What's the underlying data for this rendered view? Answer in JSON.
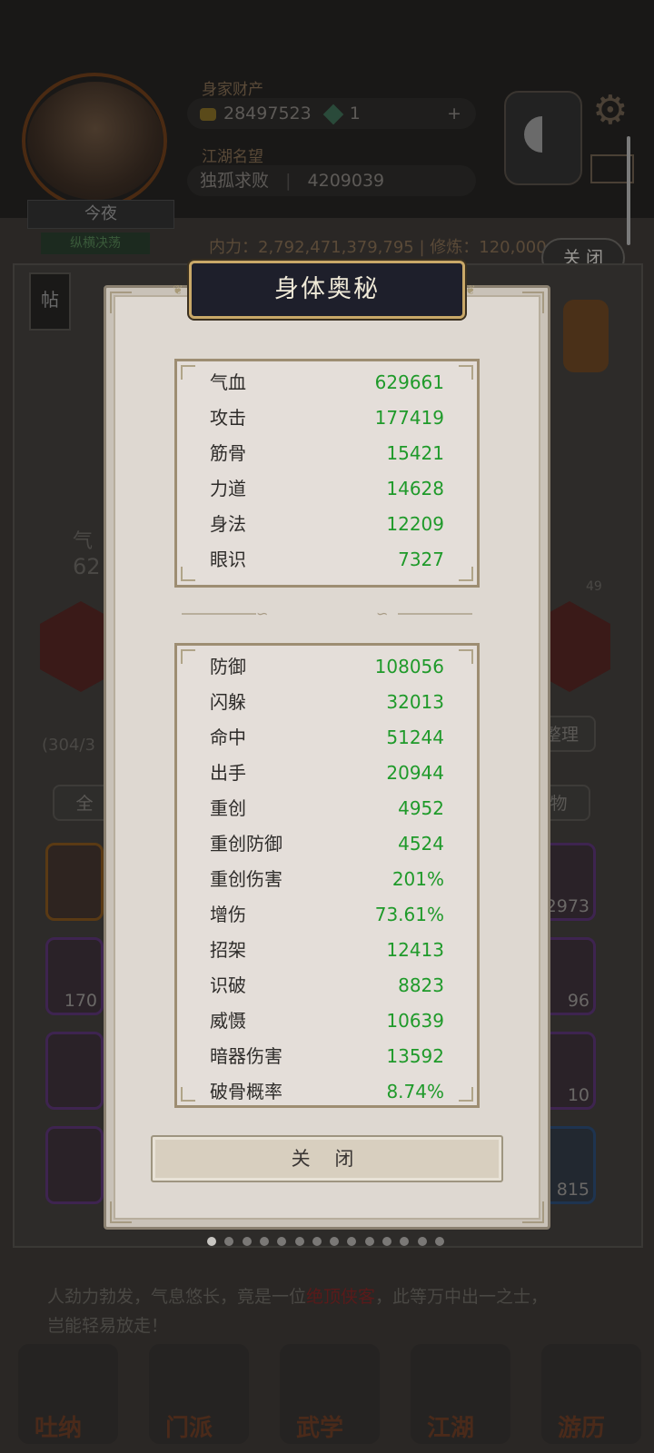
{
  "background": {
    "player_name": "今夜",
    "player_title": "纵横决荡",
    "wealth_label": "身家财产",
    "coins": "28497523",
    "gems": "1",
    "plus": "+",
    "reputation_label": "江湖名望",
    "reputation_title": "独孤求败",
    "reputation_value": "4209039",
    "info_line": "内力：2,792,471,379,795 | 修炼：120,000",
    "close_label": "关 闭",
    "tie_label": "帖",
    "left_value": "62",
    "left_label": "气",
    "progress_text": "(304/3",
    "sort_label": "整理",
    "tab_all": "全",
    "tab_item": "物",
    "item_counts": [
      "170",
      "2973",
      "96",
      "10",
      "815"
    ],
    "side_num": "49",
    "description_pre": "人劲力勃发，气息悠长，竟是一位",
    "description_hl": "绝顶侠客",
    "description_post": "，此等万中出一之士，",
    "description_line2": "岂能轻易放走！",
    "nav": [
      "吐纳",
      "门派",
      "武学",
      "江湖",
      "游历"
    ]
  },
  "modal": {
    "title": "身体奥秘",
    "primary_stats": [
      {
        "label": "气血",
        "value": "629661"
      },
      {
        "label": "攻击",
        "value": "177419"
      },
      {
        "label": "筋骨",
        "value": "15421"
      },
      {
        "label": "力道",
        "value": "14628"
      },
      {
        "label": "身法",
        "value": "12209"
      },
      {
        "label": "眼识",
        "value": "7327"
      }
    ],
    "secondary_stats": [
      {
        "label": "防御",
        "value": "108056"
      },
      {
        "label": "闪躲",
        "value": "32013"
      },
      {
        "label": "命中",
        "value": "51244"
      },
      {
        "label": "出手",
        "value": "20944"
      },
      {
        "label": "重创",
        "value": "4952"
      },
      {
        "label": "重创防御",
        "value": "4524"
      },
      {
        "label": "重创伤害",
        "value": "201%"
      },
      {
        "label": "增伤",
        "value": "73.61%"
      },
      {
        "label": "招架",
        "value": "12413"
      },
      {
        "label": "识破",
        "value": "8823"
      },
      {
        "label": "威慑",
        "value": "10639"
      },
      {
        "label": "暗器伤害",
        "value": "13592"
      },
      {
        "label": "破骨概率",
        "value": "8.74%"
      }
    ],
    "close_button": "关 闭",
    "page_dots_total": 14,
    "page_dot_active": 0
  },
  "colors": {
    "value_green": "#1f9a2a",
    "title_plate": "#1e1f2b",
    "panel_border": "#9d8d72"
  }
}
